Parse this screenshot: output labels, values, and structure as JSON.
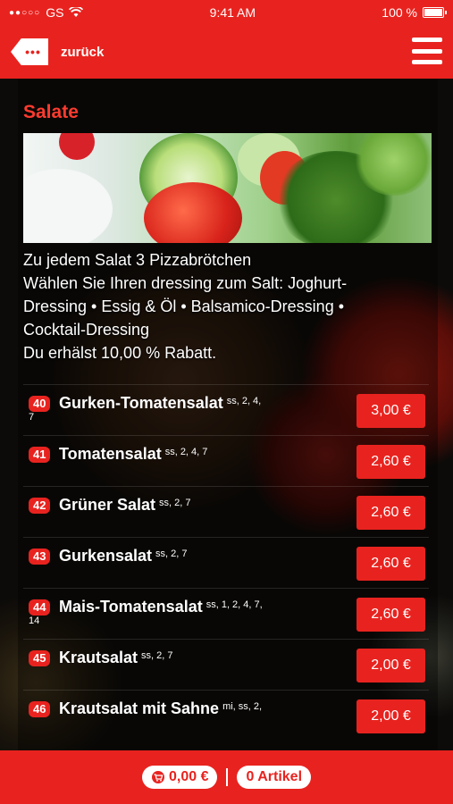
{
  "status": {
    "carrier": "GS",
    "time": "9:41 AM",
    "battery": "100 %"
  },
  "nav": {
    "back_label": "zurück",
    "back_icon": "tag-dots-icon",
    "menu_icon": "hamburger-icon"
  },
  "section": {
    "title": "Salate",
    "banner_icon": "salad-image"
  },
  "description": {
    "line1": "Zu jedem Salat 3 Pizzabrötchen",
    "line2": "Wählen Sie Ihren dressing zum Salt: Joghurt-",
    "line3": "Dressing • Essig & Öl • Balsamico-Dressing •",
    "line4": "Cocktail-Dressing",
    "line5": "Du erhälst 10,00 % Rabatt."
  },
  "items": [
    {
      "num": "40",
      "name": "Gurken-Tomatensalat",
      "sup": "ss, 2, 4,",
      "wrap": "7",
      "price": "3,00 €"
    },
    {
      "num": "41",
      "name": "Tomatensalat",
      "sup": "ss, 2, 4, 7",
      "wrap": "",
      "price": "2,60 €"
    },
    {
      "num": "42",
      "name": "Grüner Salat",
      "sup": "ss, 2, 7",
      "wrap": "",
      "price": "2,60 €"
    },
    {
      "num": "43",
      "name": "Gurkensalat",
      "sup": "ss, 2, 7",
      "wrap": "",
      "price": "2,60 €"
    },
    {
      "num": "44",
      "name": "Mais-Tomatensalat",
      "sup": "ss, 1, 2, 4, 7,",
      "wrap": "14",
      "price": "2,60 €"
    },
    {
      "num": "45",
      "name": "Krautsalat",
      "sup": "ss, 2, 7",
      "wrap": "",
      "price": "2,00 €"
    },
    {
      "num": "46",
      "name": "Krautsalat mit Sahne",
      "sup": "mi, ss, 2,",
      "wrap": "",
      "price": "2,00 €"
    }
  ],
  "footer": {
    "total": "0,00 €",
    "articles": "0 Artikel",
    "cart_icon": "cart-icon"
  },
  "colors": {
    "accent": "#e8231f",
    "title": "#ff3b2f"
  }
}
